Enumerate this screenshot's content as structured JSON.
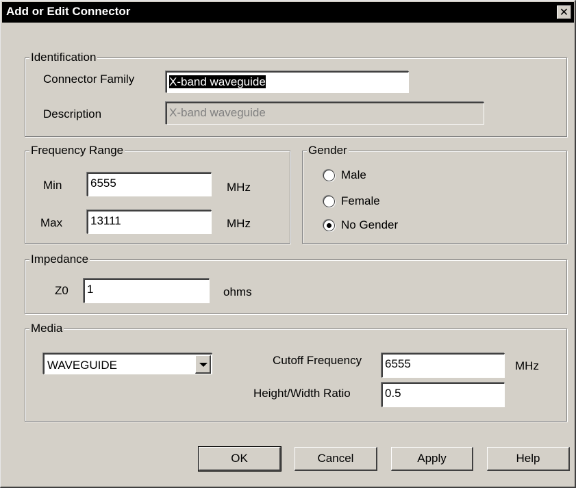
{
  "window": {
    "title": "Add or Edit Connector",
    "close_glyph": "✕"
  },
  "identification": {
    "legend": "Identification",
    "family_label": "Connector Family",
    "family_value": "X-band waveguide",
    "description_label": "Description",
    "description_value": "X-band waveguide"
  },
  "frequency": {
    "legend": "Frequency Range",
    "min_label": "Min",
    "min_value": "6555",
    "min_unit": "MHz",
    "max_label": "Max",
    "max_value": "13111",
    "max_unit": "MHz"
  },
  "gender": {
    "legend": "Gender",
    "options": [
      {
        "label": "Male",
        "checked": false
      },
      {
        "label": "Female",
        "checked": false
      },
      {
        "label": "No Gender",
        "checked": true
      }
    ]
  },
  "impedance": {
    "legend": "Impedance",
    "z0_label": "Z0",
    "z0_value": "1",
    "z0_unit": "ohms"
  },
  "media": {
    "legend": "Media",
    "type_value": "WAVEGUIDE",
    "cutoff_label": "Cutoff Frequency",
    "cutoff_value": "6555",
    "cutoff_unit": "MHz",
    "ratio_label": "Height/Width Ratio",
    "ratio_value": "0.5"
  },
  "buttons": {
    "ok": "OK",
    "cancel": "Cancel",
    "apply": "Apply",
    "help": "Help"
  },
  "colors": {
    "titlebar": "#000000",
    "face": "#d4d0c8",
    "shadow": "#808080"
  }
}
